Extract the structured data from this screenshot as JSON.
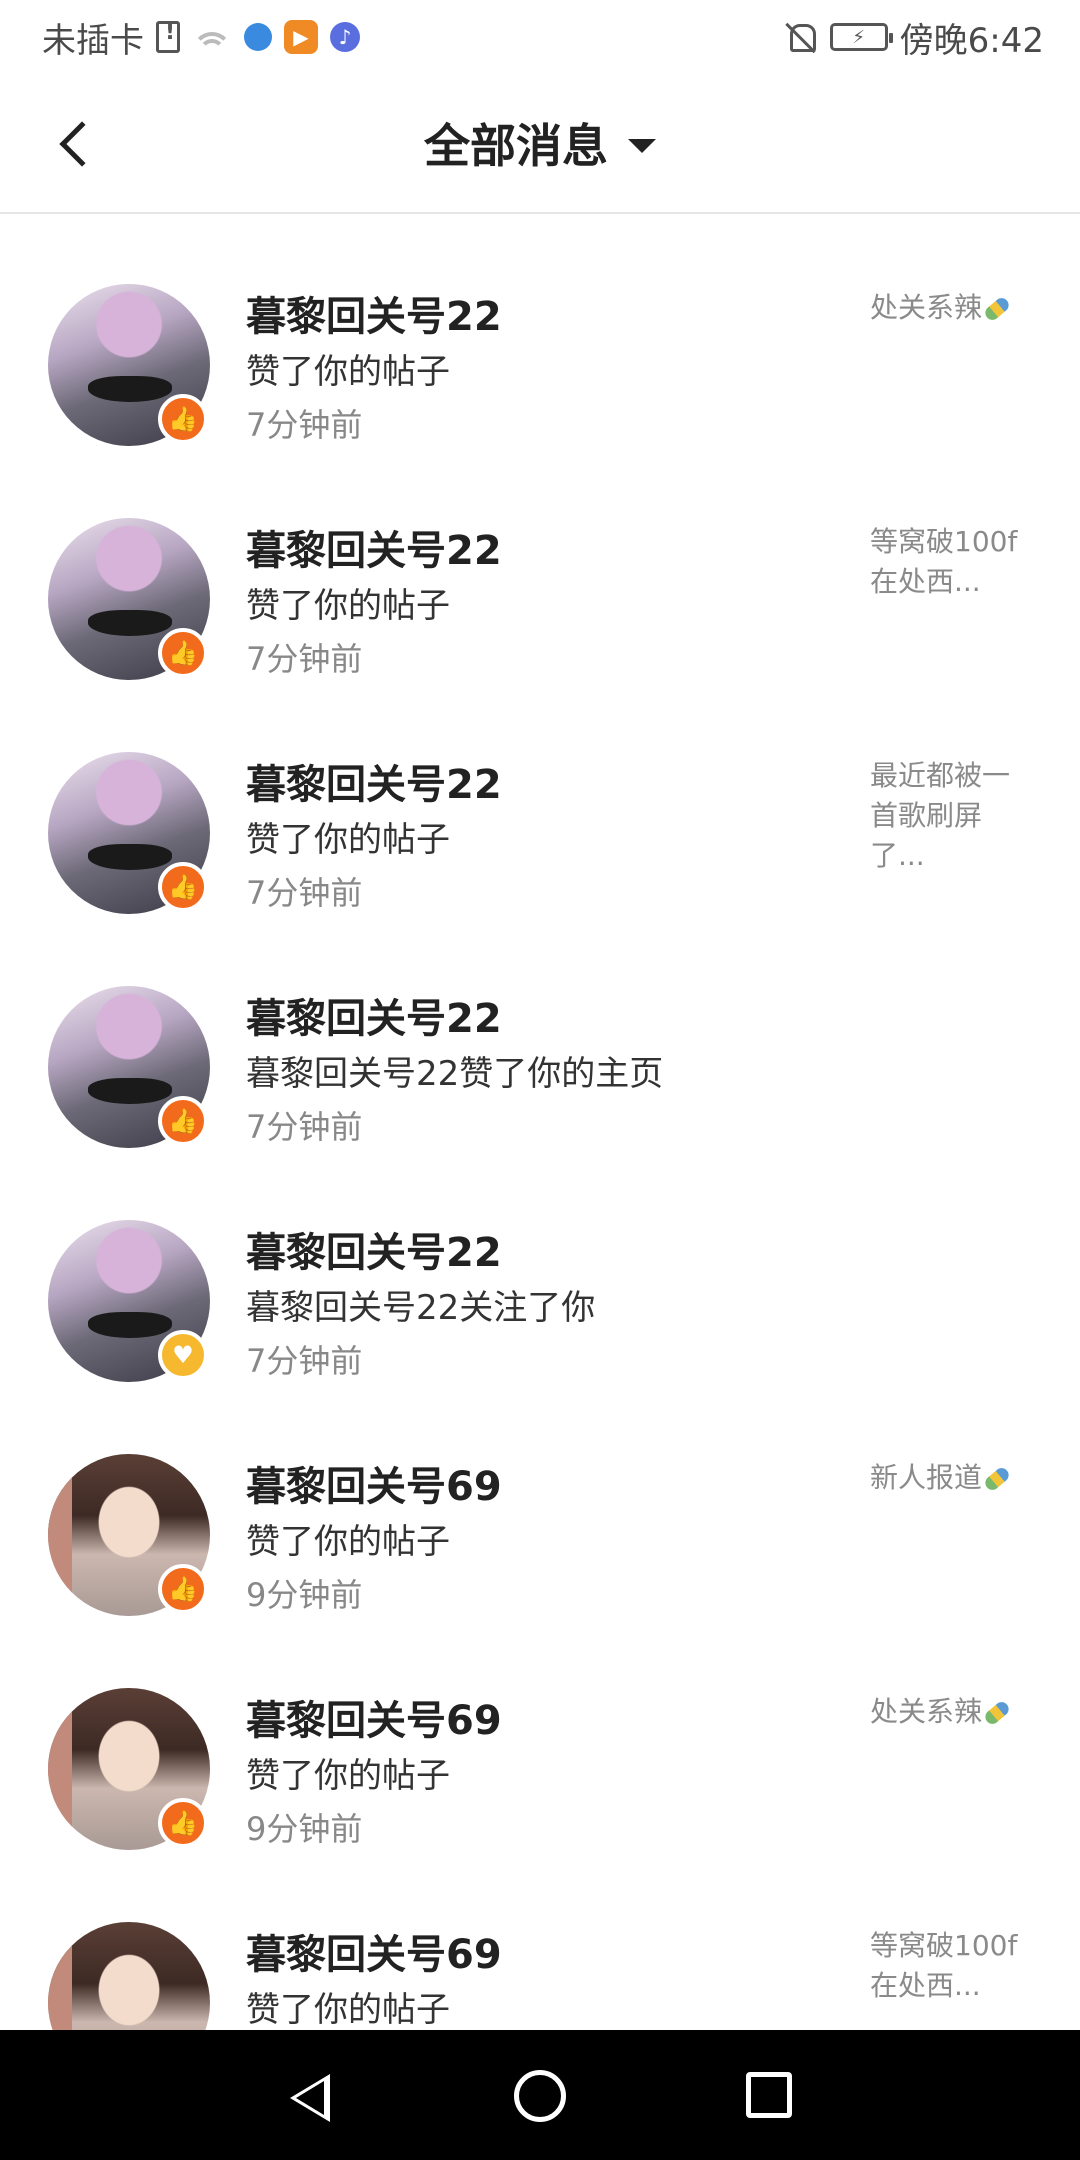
{
  "status_bar": {
    "carrier": "未插卡",
    "battery_icon": "battery-charging-icon",
    "time": "傍晚6:42"
  },
  "header": {
    "title": "全部消息",
    "back_icon": "chevron-left-icon",
    "dropdown_icon": "caret-down-icon"
  },
  "messages": [
    {
      "name": "暮黎回关号22",
      "action": "赞了你的帖子",
      "time": "7分钟前",
      "ref": "处关系辣",
      "type": "like",
      "avatar": "a"
    },
    {
      "name": "暮黎回关号22",
      "action": "赞了你的帖子",
      "time": "7分钟前",
      "ref": "等窝破100f在处西...",
      "type": "like",
      "avatar": "a"
    },
    {
      "name": "暮黎回关号22",
      "action": "赞了你的帖子",
      "time": "7分钟前",
      "ref": "最近都被一首歌刷屏了...",
      "type": "like",
      "avatar": "a"
    },
    {
      "name": "暮黎回关号22",
      "action": "暮黎回关号22赞了你的主页",
      "time": "7分钟前",
      "ref": "",
      "type": "like",
      "avatar": "a"
    },
    {
      "name": "暮黎回关号22",
      "action": "暮黎回关号22关注了你",
      "time": "7分钟前",
      "ref": "",
      "type": "follow",
      "avatar": "a"
    },
    {
      "name": "暮黎回关号69",
      "action": "赞了你的帖子",
      "time": "9分钟前",
      "ref": "新人报道",
      "type": "like",
      "avatar": "b"
    },
    {
      "name": "暮黎回关号69",
      "action": "赞了你的帖子",
      "time": "9分钟前",
      "ref": "处关系辣",
      "type": "like",
      "avatar": "b"
    },
    {
      "name": "暮黎回关号69",
      "action": "赞了你的帖子",
      "time": "",
      "ref": "等窝破100f在处西...",
      "type": "like",
      "avatar": "b"
    }
  ],
  "nav_bar": {
    "back_icon": "triangle-back-icon",
    "home_icon": "circle-home-icon",
    "recents_icon": "square-recents-icon"
  }
}
